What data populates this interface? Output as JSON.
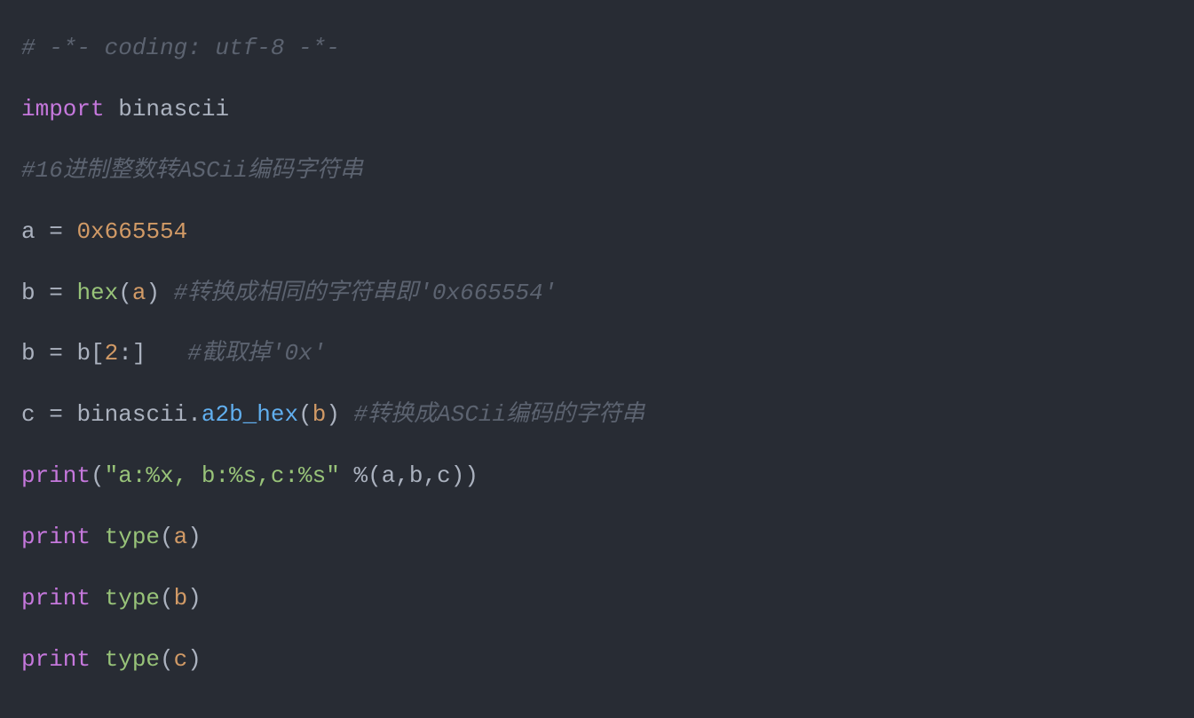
{
  "lines": {
    "l1_comment": "# -*- coding: utf-8 -*-",
    "l2_import": "import",
    "l2_module": " binascii",
    "l3_comment": "#16进制整数转ASCii编码字符串",
    "l4_var": "a ",
    "l4_eq": "= ",
    "l4_num": "0x665554",
    "l5_var": "b ",
    "l5_eq": "= ",
    "l5_func": "hex",
    "l5_open": "(",
    "l5_arg": "a",
    "l5_close": ")",
    "l5_comment": " #转换成相同的字符串即'0x665554'",
    "l6_var": "b ",
    "l6_eq": "= ",
    "l6_ref": "b",
    "l6_bracket_open": "[",
    "l6_idx": "2",
    "l6_colon": ":",
    "l6_bracket_close": "]",
    "l6_space": "   ",
    "l6_comment": "#截取掉'0x'",
    "l7_var": "c ",
    "l7_eq": "= ",
    "l7_obj": "binascii",
    "l7_dot": ".",
    "l7_method": "a2b_hex",
    "l7_open": "(",
    "l7_arg": "b",
    "l7_close": ")",
    "l7_comment": " #转换成ASCii编码的字符串",
    "l8_print": "print",
    "l8_open": "(",
    "l8_str": "\"a:%x, b:%s,c:%s\"",
    "l8_space": " ",
    "l8_pct": "%",
    "l8_open2": "(",
    "l8_a": "a",
    "l8_c1": ",",
    "l8_b": "b",
    "l8_c2": ",",
    "l8_c": "c",
    "l8_close2": ")",
    "l8_close": ")",
    "l9_print": "print",
    "l9_space": " ",
    "l9_type": "type",
    "l9_open": "(",
    "l9_arg": "a",
    "l9_close": ")",
    "l10_print": "print",
    "l10_space": " ",
    "l10_type": "type",
    "l10_open": "(",
    "l10_arg": "b",
    "l10_close": ")",
    "l11_print": "print",
    "l11_space": " ",
    "l11_type": "type",
    "l11_open": "(",
    "l11_arg": "c",
    "l11_close": ")"
  }
}
